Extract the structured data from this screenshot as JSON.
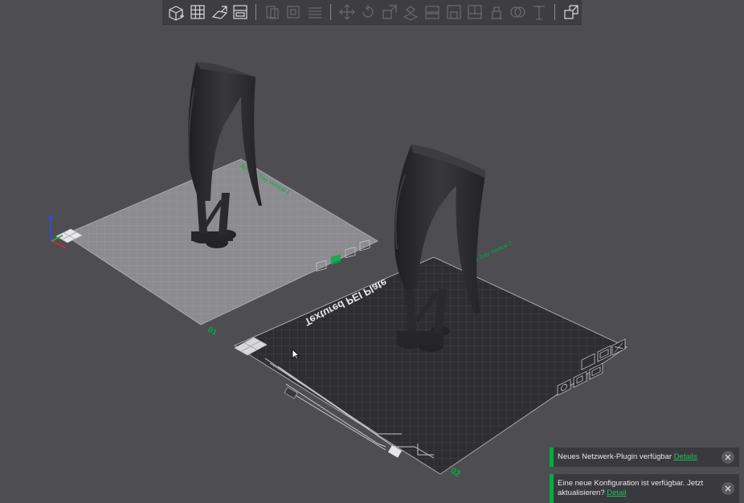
{
  "toolbar": {
    "buttons": [
      {
        "name": "add-cube-button",
        "icon": "add-cube-icon",
        "state": "active"
      },
      {
        "name": "arrange-grid-button",
        "icon": "grid-icon",
        "state": "active"
      },
      {
        "name": "orient-button",
        "icon": "orient-icon",
        "state": "active"
      },
      {
        "name": "plate-settings-button",
        "icon": "plate-settings-icon",
        "state": "active"
      },
      {
        "name": "split-objects-button",
        "icon": "split-objects-icon",
        "state": "dim"
      },
      {
        "name": "split-parts-button",
        "icon": "split-parts-icon",
        "state": "dim"
      },
      {
        "name": "layers-button",
        "icon": "layers-icon",
        "state": "dim"
      },
      {
        "name": "move-button",
        "icon": "move-icon",
        "state": "dim"
      },
      {
        "name": "rotate-button",
        "icon": "rotate-icon",
        "state": "dim"
      },
      {
        "name": "scale-button",
        "icon": "scale-icon",
        "state": "dim"
      },
      {
        "name": "lay-on-face-button",
        "icon": "lay-on-face-icon",
        "state": "dim"
      },
      {
        "name": "cut-button",
        "icon": "cut-icon",
        "state": "dim"
      },
      {
        "name": "support-paint-button",
        "icon": "support-paint-icon",
        "state": "dim"
      },
      {
        "name": "seam-paint-button",
        "icon": "seam-paint-icon",
        "state": "dim"
      },
      {
        "name": "color-paint-button",
        "icon": "color-paint-icon",
        "state": "dim"
      },
      {
        "name": "boolean-button",
        "icon": "boolean-icon",
        "state": "dim"
      },
      {
        "name": "text-button",
        "icon": "text-icon",
        "state": "dim"
      },
      {
        "name": "assembly-view-button",
        "icon": "assembly-view-icon",
        "state": "active"
      }
    ]
  },
  "plates": [
    {
      "number": "01",
      "filament_label": "Sponge Tray Vertical 2",
      "selected": false
    },
    {
      "number": "02",
      "filament_label": "Sponge Tray Vertical 2",
      "plate_type": "Textured PEI Plate",
      "selected": true
    }
  ],
  "notifications": [
    {
      "text": "Neues Netzwerk-Plugin verfügbar",
      "link": "Details"
    },
    {
      "text": "Eine neue Konfiguration ist verfügbar. Jetzt aktualisieren?",
      "link": "Detail"
    }
  ],
  "colors": {
    "background": "#4d4d52",
    "toolbar": "#3e3e42",
    "accent": "#00ae42",
    "plate1": "#8c8c90",
    "plate2": "#2e2e32",
    "model": "#2a2a2c"
  }
}
